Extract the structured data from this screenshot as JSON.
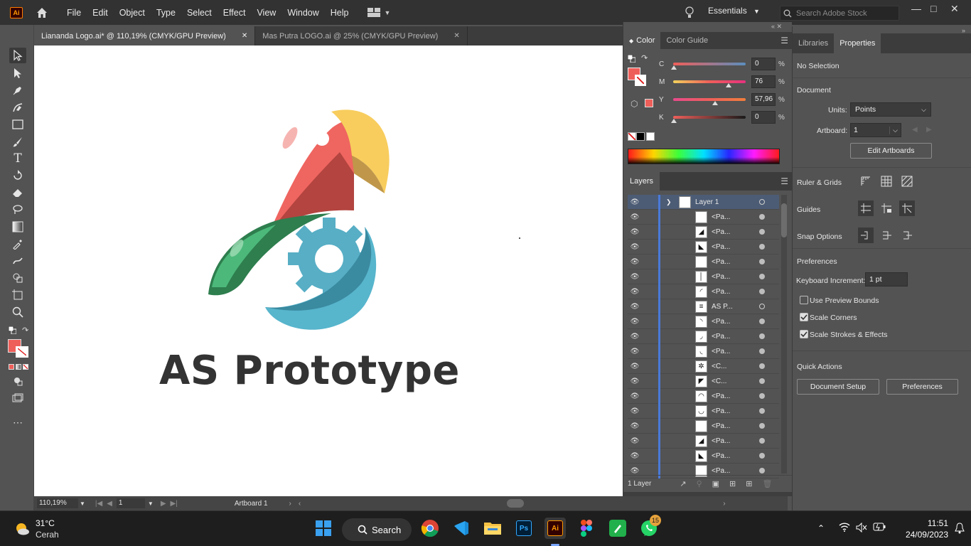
{
  "app": {
    "logo_text": "Ai"
  },
  "menubar": {
    "items": [
      "File",
      "Edit",
      "Object",
      "Type",
      "Select",
      "Effect",
      "View",
      "Window",
      "Help"
    ],
    "workspace": "Essentials",
    "search_placeholder": "Search Adobe Stock"
  },
  "tabs": [
    {
      "label": "Liananda Logo.ai* @ 110,19% (CMYK/GPU Preview)",
      "active": true
    },
    {
      "label": "Mas Putra LOGO.ai @ 25% (CMYK/GPU Preview)",
      "active": false
    }
  ],
  "canvas": {
    "logo_text": "AS Prototype"
  },
  "statusbar": {
    "zoom": "110,19%",
    "artboard_num": "1",
    "artboard_label": "Artboard 1"
  },
  "color_panel": {
    "tabs": [
      "Color",
      "Color Guide"
    ],
    "fill_color": "#ef5f5a",
    "sliders": [
      {
        "label": "C",
        "value": "0",
        "pct": "%"
      },
      {
        "label": "M",
        "value": "76",
        "pct": "%"
      },
      {
        "label": "Y",
        "value": "57,96",
        "pct": "%"
      },
      {
        "label": "K",
        "value": "0",
        "pct": "%"
      }
    ]
  },
  "layers_panel": {
    "title": "Layers",
    "top_layer": "Layer 1",
    "rows": [
      "<Pa...",
      "<Pa...",
      "<Pa...",
      "<Pa...",
      "<Pa...",
      "<Pa...",
      "AS P...",
      "<Pa...",
      "<Pa...",
      "<Pa...",
      "<C...",
      "<C...",
      "<Pa...",
      "<Pa...",
      "<Pa...",
      "<Pa...",
      "<Pa...",
      "<Pa..."
    ],
    "footer": "1 Layer"
  },
  "properties": {
    "tabs": [
      "Libraries",
      "Properties"
    ],
    "selection": "No Selection",
    "document_label": "Document",
    "units_label": "Units:",
    "units_value": "Points",
    "artboard_label": "Artboard:",
    "artboard_value": "1",
    "edit_artboards": "Edit Artboards",
    "ruler_grids": "Ruler & Grids",
    "guides": "Guides",
    "snap_options": "Snap Options",
    "preferences_label": "Preferences",
    "keyboard_increment_label": "Keyboard Increment:",
    "keyboard_increment_value": "1 pt",
    "checks": [
      {
        "label": "Use Preview Bounds",
        "checked": false
      },
      {
        "label": "Scale Corners",
        "checked": true
      },
      {
        "label": "Scale Strokes & Effects",
        "checked": true
      }
    ],
    "quick_actions": "Quick Actions",
    "document_setup": "Document Setup",
    "preferences_btn": "Preferences"
  },
  "taskbar": {
    "weather_temp": "31°C",
    "weather_desc": "Cerah",
    "search": "Search",
    "time": "11:51",
    "date": "24/09/2023",
    "whatsapp_badge": "15",
    "ps_label": "Ps",
    "ai_label": "Ai"
  }
}
